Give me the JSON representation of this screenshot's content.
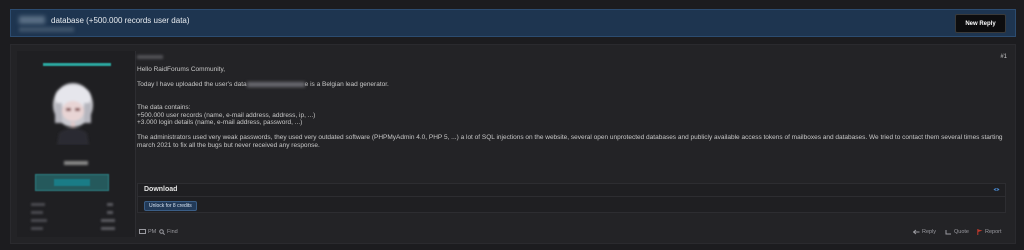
{
  "thread": {
    "title": "database (+500.000 records user data)",
    "new_reply_label": "New Reply"
  },
  "post": {
    "number": "#1",
    "greeting": "Hello RaidForums Community,",
    "line2_a": "Today I have uploaded the user's data",
    "line2_b": "e is a Belgian lead generator.",
    "contains_heading": "The data contains:",
    "contains_item1": "+500.000 user records (name, e-mail address, address, ip, ...)",
    "contains_item2": "+3.000 login details (name, e-mail address, password, ...)",
    "paragraph": "The administrators used very weak passwords, they used very outdated software (PHPMyAdmin 4.0, PHP 5, ...) a lot of SQL injections on the website, several open unprotected databases and publicly available access tokens of mailboxes and databases. We tried to contact them several times starting march 2021 to fix all the bugs but never received any response.",
    "download": {
      "title": "Download",
      "unlock_label": "Unlock for 8 credits"
    },
    "actions": {
      "pm": "PM",
      "find": "Find",
      "reply": "Reply",
      "quote": "Quote",
      "report": "Report"
    }
  },
  "colors": {
    "header_bg": "#1e3550",
    "page_bg": "#1c1c1f",
    "post_bg": "#232326",
    "accent_teal": "#2ba8a0",
    "report_red": "#c0392b"
  }
}
